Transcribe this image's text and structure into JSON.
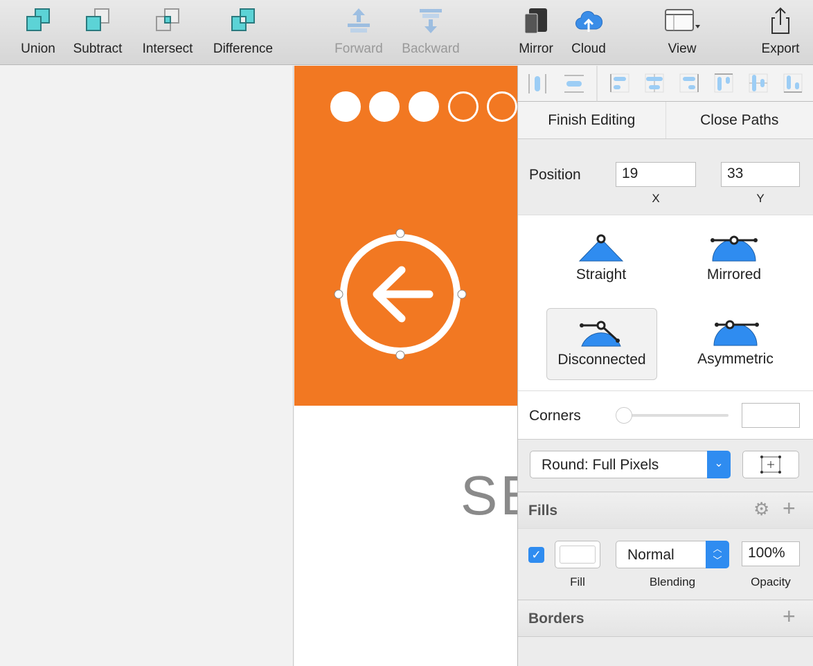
{
  "toolbar": {
    "items": [
      {
        "label": "Union",
        "icon": "union-icon"
      },
      {
        "label": "Subtract",
        "icon": "subtract-icon"
      },
      {
        "label": "Intersect",
        "icon": "intersect-icon"
      },
      {
        "label": "Difference",
        "icon": "difference-icon"
      },
      {
        "label": "Forward",
        "icon": "forward-icon",
        "disabled": true
      },
      {
        "label": "Backward",
        "icon": "backward-icon",
        "disabled": true
      },
      {
        "label": "Mirror",
        "icon": "mirror-icon"
      },
      {
        "label": "Cloud",
        "icon": "cloud-icon"
      },
      {
        "label": "View",
        "icon": "view-icon"
      },
      {
        "label": "Export",
        "icon": "export-icon"
      }
    ]
  },
  "canvas": {
    "text": "SE",
    "page_dots": {
      "filled": 3,
      "total": 5
    },
    "accent": "#f27822"
  },
  "inspector": {
    "finish_editing": "Finish Editing",
    "close_paths": "Close Paths",
    "position": {
      "label": "Position",
      "x": "19",
      "y": "33",
      "x_label": "X",
      "y_label": "Y"
    },
    "handles": [
      {
        "label": "Straight"
      },
      {
        "label": "Mirrored"
      },
      {
        "label": "Disconnected",
        "selected": true
      },
      {
        "label": "Asymmetric"
      }
    ],
    "corners": {
      "label": "Corners",
      "value": "",
      "slider": 0
    },
    "rounding": "Round: Full Pixels",
    "fills": {
      "title": "Fills",
      "enabled": true,
      "color": "#ffffff",
      "blending": "Normal",
      "opacity": "100%",
      "fill_label": "Fill",
      "blending_label": "Blending",
      "opacity_label": "Opacity"
    },
    "borders": {
      "title": "Borders"
    },
    "accent": "#2f8cf0"
  }
}
